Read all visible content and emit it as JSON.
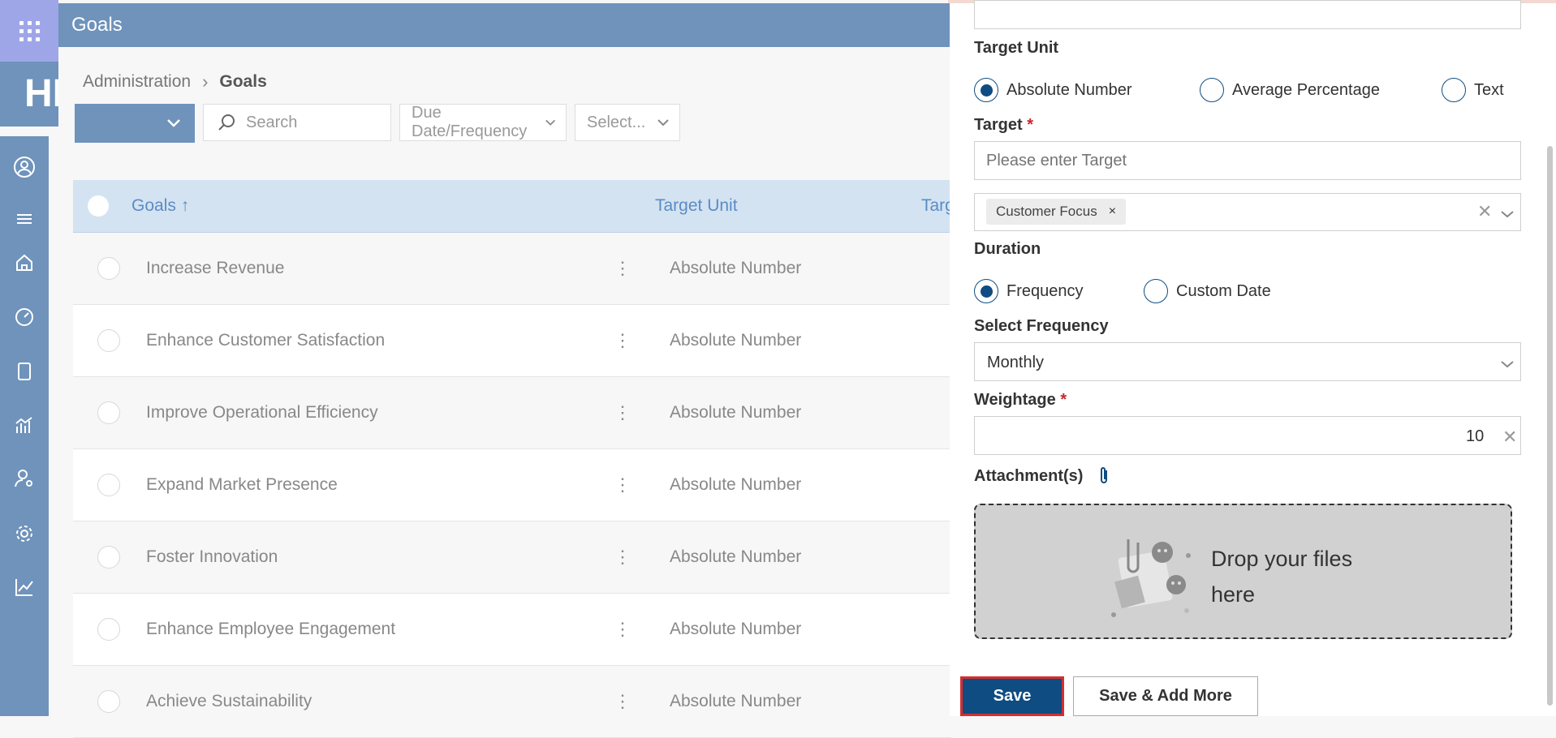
{
  "header": {
    "title": "Goals",
    "brand_fragment": "HI"
  },
  "breadcrumb": {
    "parent": "Administration",
    "current": "Goals"
  },
  "toolbar": {
    "search_placeholder": "Search",
    "due_date_filter": "Due Date/Frequency",
    "select_filter": "Select..."
  },
  "table": {
    "columns": {
      "goals": "Goals ↑",
      "target_unit": "Target Unit",
      "target": "Targ"
    },
    "rows": [
      {
        "name": "Increase Revenue",
        "unit": "Absolute Number"
      },
      {
        "name": "Enhance Customer Satisfaction",
        "unit": "Absolute Number"
      },
      {
        "name": "Improve Operational Efficiency",
        "unit": "Absolute Number"
      },
      {
        "name": "Expand Market Presence",
        "unit": "Absolute Number"
      },
      {
        "name": "Foster Innovation",
        "unit": "Absolute Number"
      },
      {
        "name": "Enhance Employee Engagement",
        "unit": "Absolute Number"
      },
      {
        "name": "Achieve Sustainability",
        "unit": "Absolute Number"
      }
    ],
    "row_menu_glyph": "⋮"
  },
  "panel": {
    "target_unit_label": "Target Unit",
    "target_unit_options": [
      "Absolute Number",
      "Average Percentage",
      "Text"
    ],
    "target_unit_selected": "Absolute Number",
    "target_label": "Target",
    "required_mark": "*",
    "target_placeholder": "Please enter Target",
    "tag": "Customer Focus",
    "tag_remove": "×",
    "clear_glyph": "✕",
    "duration_label": "Duration",
    "duration_options": [
      "Frequency",
      "Custom Date"
    ],
    "duration_selected": "Frequency",
    "frequency_label": "Select Frequency",
    "frequency_value": "Monthly",
    "weightage_label": "Weightage",
    "weightage_value": "10",
    "attachments_label": "Attachment(s)",
    "dropzone_text": "Drop your files here",
    "save_label": "Save",
    "save_add_label": "Save & Add More"
  },
  "colors": {
    "header_bg": "#6f93bb",
    "apps_bg": "#9fa6e8",
    "primary": "#0f4c81",
    "table_header_bg": "#d4e3f1",
    "highlight_border": "#d32f2f"
  }
}
